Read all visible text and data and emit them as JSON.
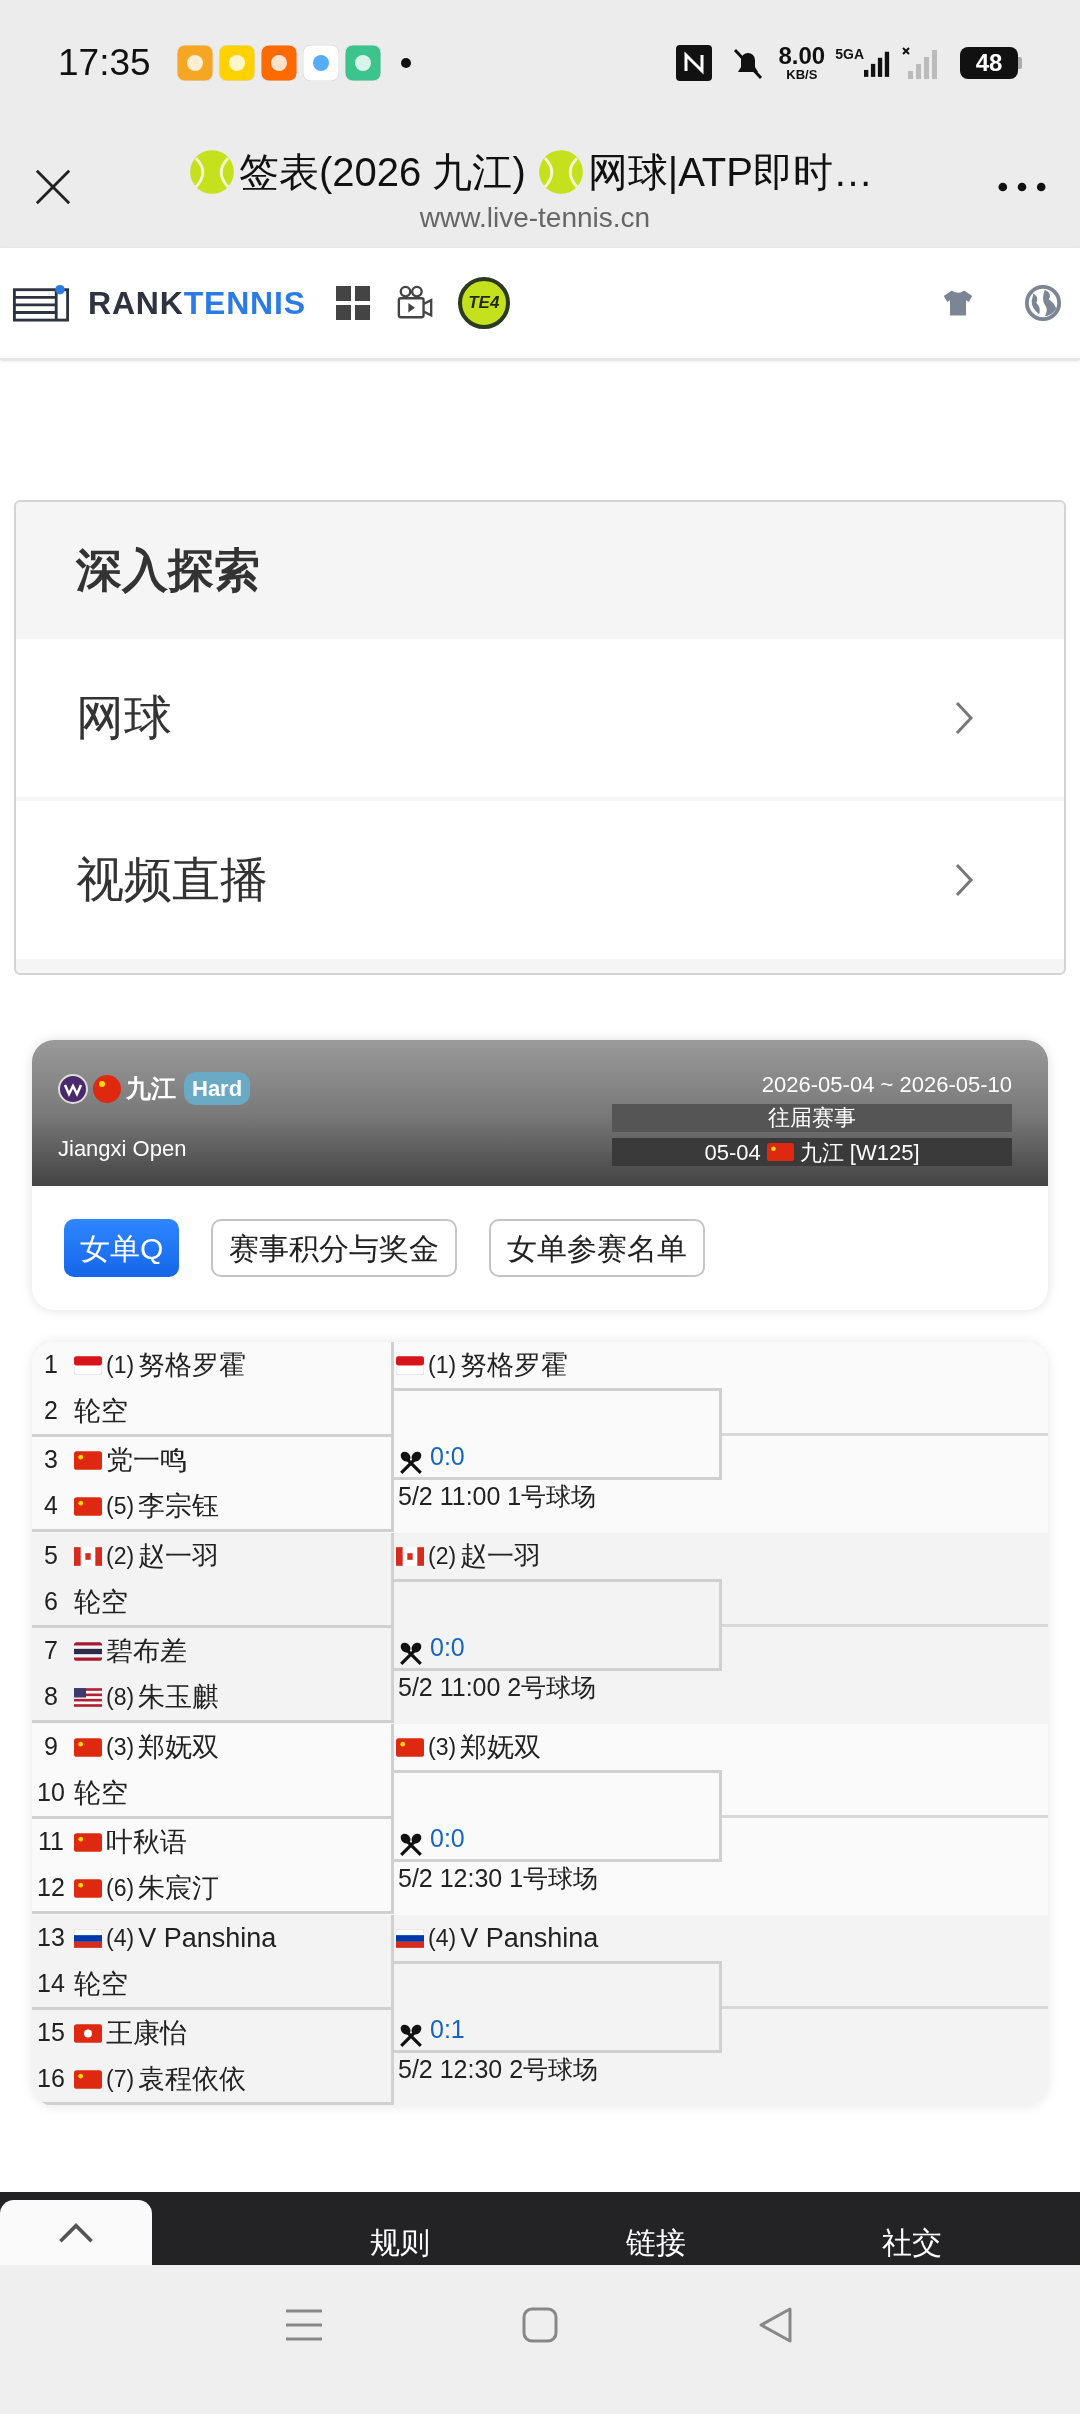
{
  "status_bar": {
    "time": "17:35",
    "speed": "8.00",
    "speed_unit": "KB/S",
    "network": "5GA",
    "battery": "48"
  },
  "browser": {
    "title_parts": [
      "签表(2026 九江)",
      "网球|ATP即时…"
    ],
    "url": "www.live-tennis.cn"
  },
  "site_header": {
    "logo_left": "RANK",
    "logo_right": "TENNIS",
    "badge": "TE4"
  },
  "explore": {
    "heading": "深入探索",
    "items": [
      "网球",
      "视频直播"
    ]
  },
  "tournament": {
    "flag": {
      "kind": "cn"
    },
    "city": "九江",
    "surface": "Hard",
    "name": "Jiangxi Open",
    "dates": "2026-05-04 ~ 2026-05-10",
    "past_label": "往届赛事",
    "past_entry": {
      "date": "05-04",
      "flag": {
        "kind": "cn"
      },
      "label": "九江 [W125]"
    }
  },
  "tabs": [
    {
      "label": "女单Q",
      "selected": true
    },
    {
      "label": "赛事积分与奖金",
      "selected": false
    },
    {
      "label": "女单参赛名单",
      "selected": false
    }
  ],
  "bracket": [
    {
      "entries": [
        {
          "no": "1",
          "flag": {
            "kind": "id"
          },
          "seed": "(1)",
          "name": "努格罗霍"
        },
        {
          "no": "2",
          "name": "轮空"
        },
        {
          "no": "3",
          "flag": {
            "kind": "cn"
          },
          "name": "党一鸣"
        },
        {
          "no": "4",
          "flag": {
            "kind": "cn"
          },
          "seed": "(5)",
          "name": "李宗钰"
        }
      ],
      "winner": {
        "flag": {
          "kind": "id"
        },
        "seed": "(1)",
        "name": "努格罗霍"
      },
      "score": "0:0",
      "schedule": "5/2 11:00 1号球场"
    },
    {
      "entries": [
        {
          "no": "5",
          "flag": {
            "kind": "ca"
          },
          "seed": "(2)",
          "name": "赵一羽"
        },
        {
          "no": "6",
          "name": "轮空"
        },
        {
          "no": "7",
          "flag": {
            "kind": "th"
          },
          "name": "碧布差"
        },
        {
          "no": "8",
          "flag": {
            "kind": "us"
          },
          "seed": "(8)",
          "name": "朱玉麒"
        }
      ],
      "winner": {
        "flag": {
          "kind": "ca"
        },
        "seed": "(2)",
        "name": "赵一羽"
      },
      "score": "0:0",
      "schedule": "5/2 11:00 2号球场"
    },
    {
      "entries": [
        {
          "no": "9",
          "flag": {
            "kind": "cn"
          },
          "seed": "(3)",
          "name": "郑妩双"
        },
        {
          "no": "10",
          "name": "轮空"
        },
        {
          "no": "11",
          "flag": {
            "kind": "cn"
          },
          "name": "叶秋语"
        },
        {
          "no": "12",
          "flag": {
            "kind": "cn"
          },
          "seed": "(6)",
          "name": "朱宸汀"
        }
      ],
      "winner": {
        "flag": {
          "kind": "cn"
        },
        "seed": "(3)",
        "name": "郑妩双"
      },
      "score": "0:0",
      "schedule": "5/2 12:30 1号球场"
    },
    {
      "entries": [
        {
          "no": "13",
          "flag": {
            "kind": "ru"
          },
          "seed": "(4)",
          "name": "V Panshina"
        },
        {
          "no": "14",
          "name": "轮空"
        },
        {
          "no": "15",
          "flag": {
            "kind": "hk"
          },
          "name": "王康怡"
        },
        {
          "no": "16",
          "flag": {
            "kind": "cn"
          },
          "seed": "(7)",
          "name": "袁程依依"
        }
      ],
      "winner": {
        "flag": {
          "kind": "ru"
        },
        "seed": "(4)",
        "name": "V Panshina"
      },
      "score": "0:1",
      "schedule": "5/2 12:30 2号球场"
    }
  ],
  "footer": {
    "links": [
      "规则",
      "链接",
      "社交"
    ]
  }
}
